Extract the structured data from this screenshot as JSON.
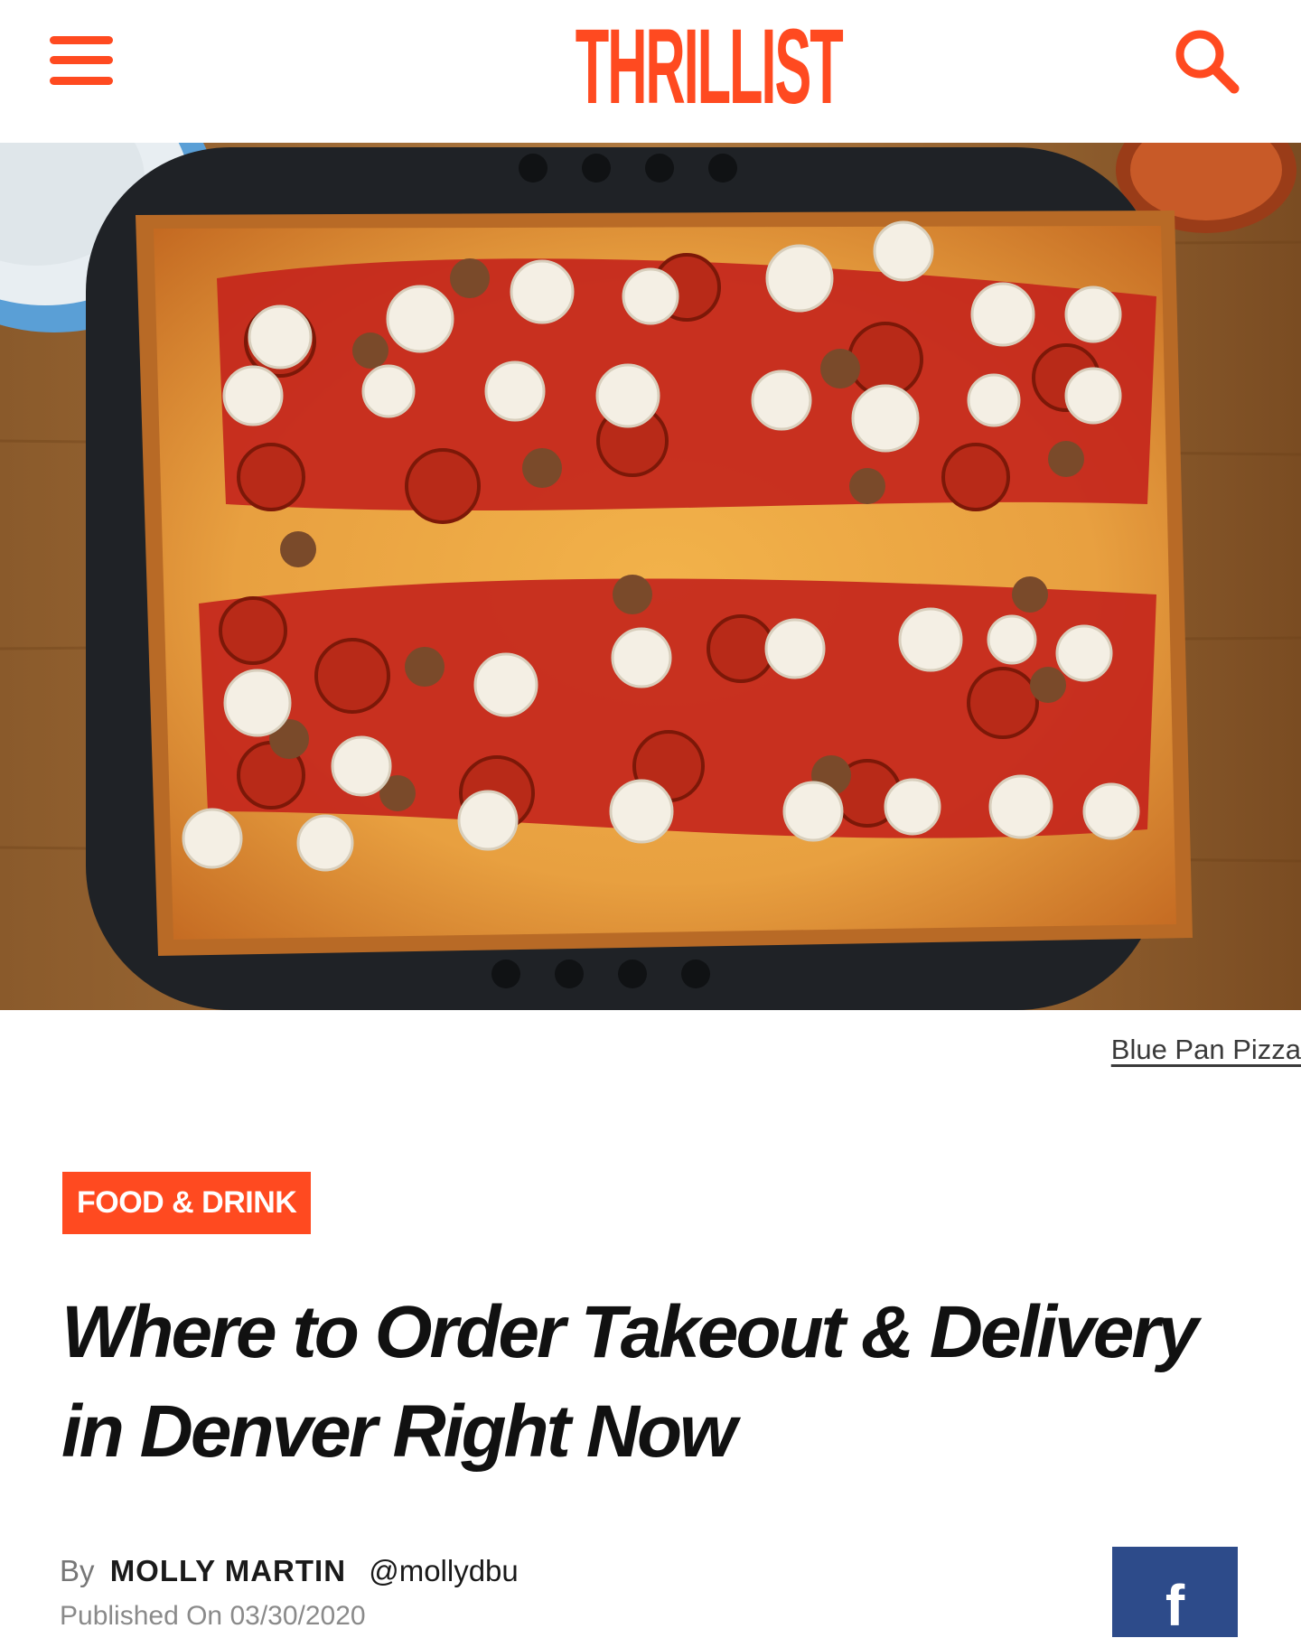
{
  "header": {
    "logo_text": "THRILLIST",
    "menu_icon": "hamburger-menu-icon",
    "search_icon": "search-icon",
    "accent_color": "#ff4a20"
  },
  "hero": {
    "image_subject": "Detroit-style square pizza with pepperoni, sausage and whipped ricotta on a dark pan",
    "credit": "Blue Pan Pizza"
  },
  "article": {
    "category": "FOOD & DRINK",
    "headline": "Where to Order Takeout & Delivery in Denver Right Now",
    "byline": {
      "by_label": "By",
      "author": "MOLLY MARTIN",
      "handle": "@mollydbu"
    },
    "published": "Published On 03/30/2020"
  },
  "share": {
    "facebook_label": "f",
    "facebook_color": "#2d4b8a"
  }
}
